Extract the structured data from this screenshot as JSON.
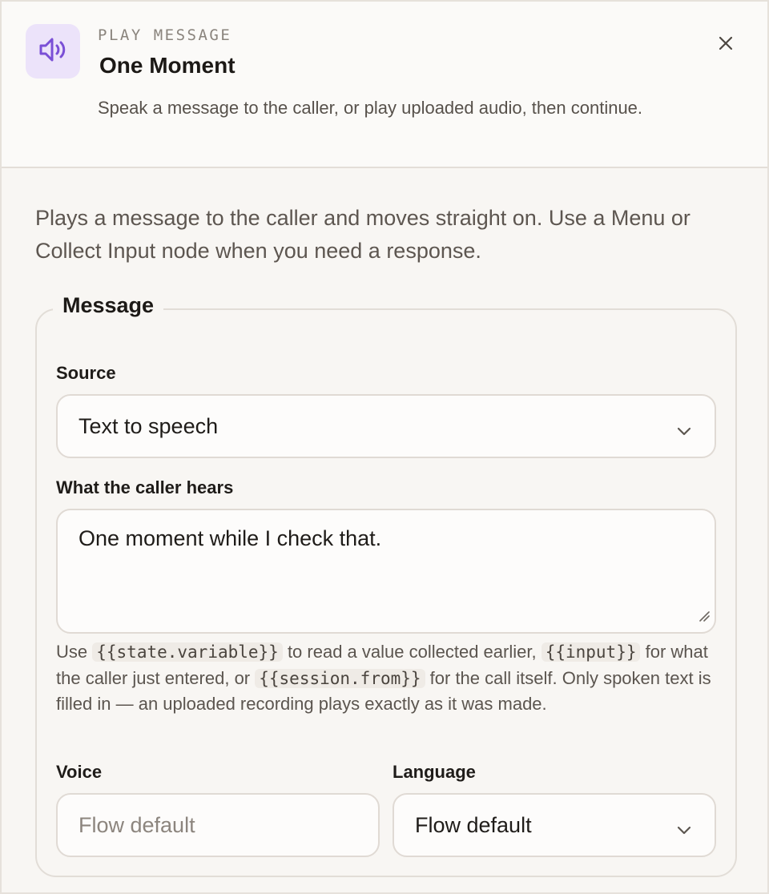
{
  "header": {
    "icon": "speaker-icon",
    "eyebrow": "PLAY MESSAGE",
    "title": "One Moment",
    "description": "Speak a message to the caller, or play uploaded audio, then continue.",
    "close_icon": "close-icon"
  },
  "intro": "Plays a message to the caller and moves straight on. Use a Menu or Collect Input node when you need a response.",
  "message_section": {
    "legend": "Message",
    "source": {
      "label": "Source",
      "value": "Text to speech"
    },
    "caller_hears": {
      "label": "What the caller hears",
      "value": "One moment while I check that."
    },
    "help": {
      "t1": "Use ",
      "c1": "{{state.variable}}",
      "t2": " to read a value collected earlier, ",
      "c2": "{{input}}",
      "t3": " for what the caller just entered, or ",
      "c3": "{{session.from}}",
      "t4": " for the call itself. Only spoken text is filled in — an uploaded recording plays exactly as it was made."
    },
    "voice": {
      "label": "Voice",
      "placeholder": "Flow default"
    },
    "language": {
      "label": "Language",
      "value": "Flow default"
    }
  },
  "colors": {
    "accent": "#7a4fd6",
    "icon_tile_bg": "#ece3fa"
  }
}
